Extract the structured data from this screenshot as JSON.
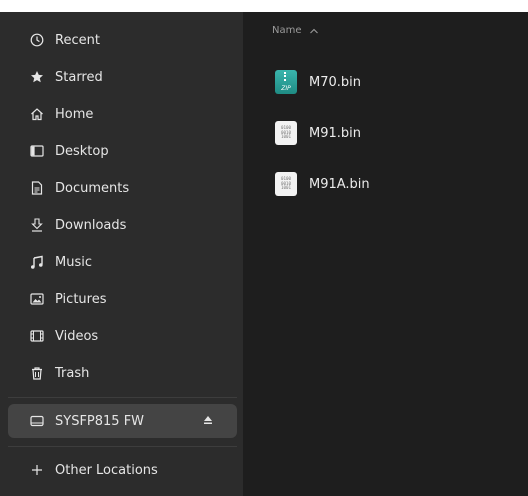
{
  "sidebar": {
    "items": [
      {
        "label": "Recent",
        "icon": "clock-icon"
      },
      {
        "label": "Starred",
        "icon": "star-icon"
      },
      {
        "label": "Home",
        "icon": "home-icon"
      },
      {
        "label": "Desktop",
        "icon": "desktop-icon"
      },
      {
        "label": "Documents",
        "icon": "document-icon"
      },
      {
        "label": "Downloads",
        "icon": "download-icon"
      },
      {
        "label": "Music",
        "icon": "music-icon"
      },
      {
        "label": "Pictures",
        "icon": "picture-icon"
      },
      {
        "label": "Videos",
        "icon": "video-icon"
      },
      {
        "label": "Trash",
        "icon": "trash-icon"
      }
    ],
    "device": {
      "label": "SYSFP815 FW",
      "icon": "drive-icon",
      "eject_icon": "eject-icon"
    },
    "other_locations": {
      "label": "Other Locations",
      "icon": "plus-icon"
    }
  },
  "main": {
    "column_header": {
      "label": "Name",
      "sort_icon": "chevron-up-icon"
    },
    "files": [
      {
        "name": "M70.bin",
        "icon": "zip-file-icon",
        "icon_text": "ZIP"
      },
      {
        "name": "M91.bin",
        "icon": "binary-file-icon",
        "icon_text": "0100 0010 1001"
      },
      {
        "name": "M91A.bin",
        "icon": "binary-file-icon",
        "icon_text": "0100 0010 1001"
      }
    ]
  },
  "colors": {
    "sidebar_bg": "#2c2c2c",
    "main_bg": "#1e1e1e",
    "selected_bg": "#444444",
    "zip_teal": "#2aa198"
  }
}
